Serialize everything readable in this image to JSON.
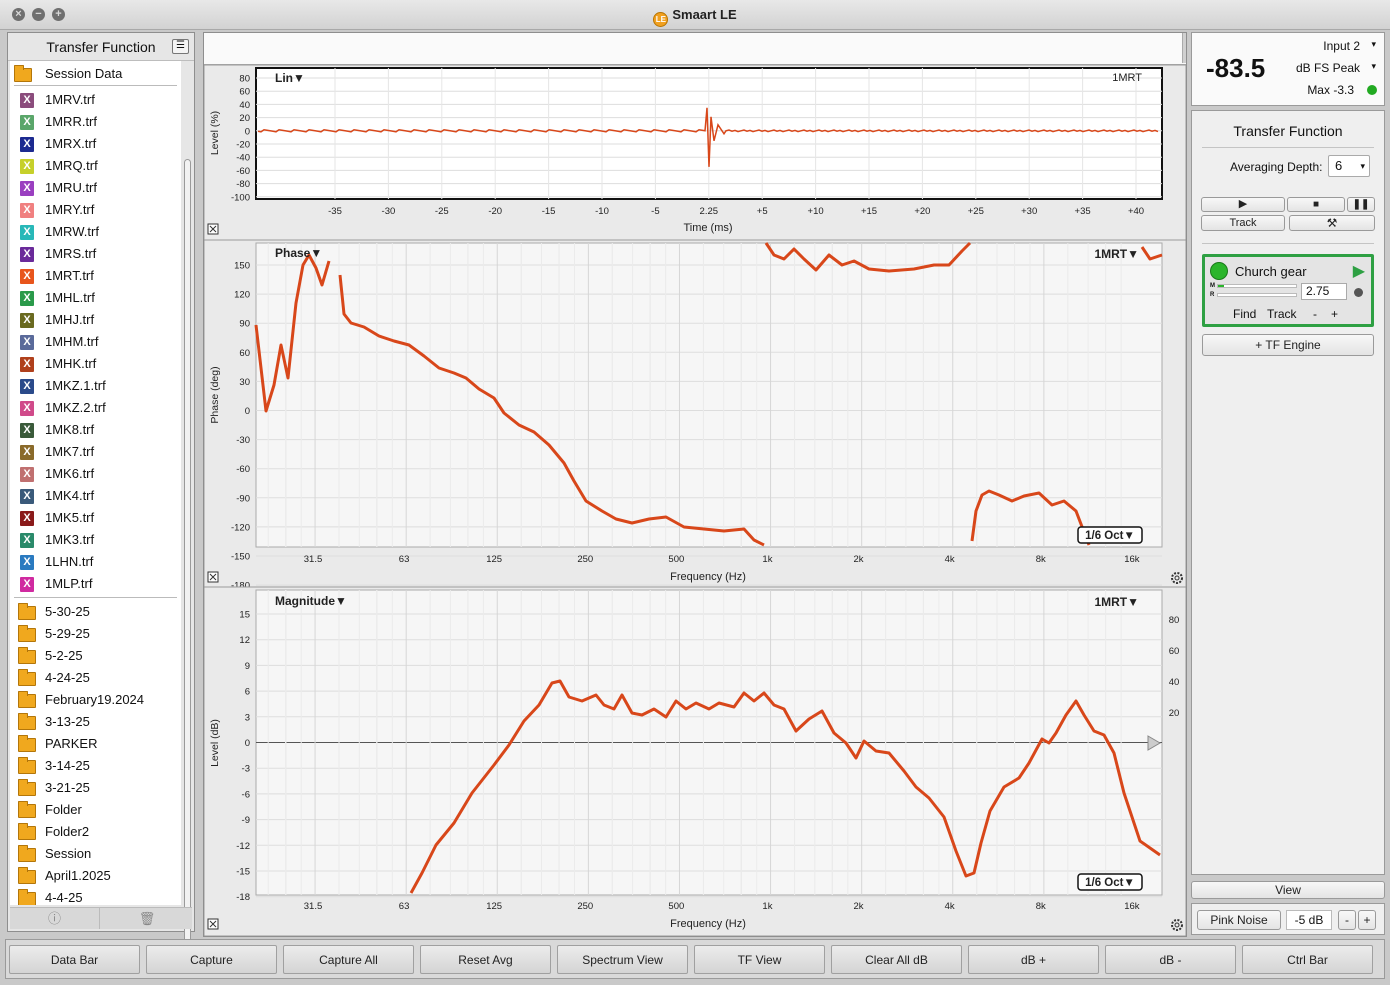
{
  "window": {
    "title": "Smaart LE",
    "logo_text": "LE"
  },
  "sidebar": {
    "title": "Transfer Function",
    "root": "Session Data",
    "files": [
      {
        "name": "1MRV.trf",
        "color": "#8b4c7c"
      },
      {
        "name": "1MRR.trf",
        "color": "#5aa66a"
      },
      {
        "name": "1MRX.trf",
        "color": "#1c2a90"
      },
      {
        "name": "1MRQ.trf",
        "color": "#c6d02a"
      },
      {
        "name": "1MRU.trf",
        "color": "#9a3fc0"
      },
      {
        "name": "1MRY.trf",
        "color": "#f08080"
      },
      {
        "name": "1MRW.trf",
        "color": "#28b8b8"
      },
      {
        "name": "1MRS.trf",
        "color": "#6a2a9a"
      },
      {
        "name": "1MRT.trf",
        "color": "#e8551c"
      },
      {
        "name": "1MHL.trf",
        "color": "#2a9a4a"
      },
      {
        "name": "1MHJ.trf",
        "color": "#6a6a20"
      },
      {
        "name": "1MHM.trf",
        "color": "#5a6a9a"
      },
      {
        "name": "1MHK.trf",
        "color": "#b0401c"
      },
      {
        "name": "1MKZ.1.trf",
        "color": "#2a4a8a"
      },
      {
        "name": "1MKZ.2.trf",
        "color": "#d04a8a"
      },
      {
        "name": "1MK8.trf",
        "color": "#3a5a3a"
      },
      {
        "name": "1MK7.trf",
        "color": "#8a6a2a"
      },
      {
        "name": "1MK6.trf",
        "color": "#c07070"
      },
      {
        "name": "1MK4.trf",
        "color": "#3a5a7a"
      },
      {
        "name": "1MK5.trf",
        "color": "#8a1a1a"
      },
      {
        "name": "1MK3.trf",
        "color": "#2a8a6a"
      },
      {
        "name": "1LHN.trf",
        "color": "#2a7ac0"
      },
      {
        "name": "1MLP.trf",
        "color": "#d02aa0"
      }
    ],
    "folders": [
      "5-30-25",
      "5-29-25",
      "5-2-25",
      "4-24-25",
      "February19.2024",
      "3-13-25",
      "PARKER",
      "3-14-25",
      "3-21-25",
      "Folder",
      "Folder2",
      "Session",
      "April1.2025",
      "4-4-25"
    ]
  },
  "ir_plot": {
    "mode": "Lin",
    "trace": "1MRT",
    "ylabel": "Level (%)",
    "xlabel": "Time (ms)",
    "yticks": [
      "80",
      "60",
      "40",
      "20",
      "0",
      "-20",
      "-40",
      "-60",
      "-80",
      "-100"
    ],
    "xticks": [
      "-35",
      "-30",
      "-25",
      "-20",
      "-15",
      "-10",
      "-5",
      "2.25",
      "+5",
      "+10",
      "+15",
      "+20",
      "+25",
      "+30",
      "+35",
      "+40"
    ]
  },
  "phase_plot": {
    "mode": "Phase",
    "trace": "1MRT",
    "smoothing": "1/6 Oct",
    "ylabel": "Phase (deg)",
    "xlabel": "Frequency (Hz)",
    "yticks": [
      "150",
      "120",
      "90",
      "60",
      "30",
      "0",
      "-30",
      "-60",
      "-90",
      "-120",
      "-150",
      "-180"
    ],
    "xticks": [
      "31.5",
      "63",
      "125",
      "250",
      "500",
      "1k",
      "2k",
      "4k",
      "8k",
      "16k"
    ]
  },
  "mag_plot": {
    "mode": "Magnitude",
    "trace": "1MRT",
    "smoothing": "1/6 Oct",
    "ylabel": "Level (dB)",
    "xlabel": "Frequency (Hz)",
    "yticks": [
      "15",
      "12",
      "9",
      "6",
      "3",
      "0",
      "-3",
      "-6",
      "-9",
      "-12",
      "-15",
      "-18"
    ],
    "right_ticks": [
      "80",
      "60",
      "40",
      "20"
    ],
    "xticks": [
      "31.5",
      "63",
      "125",
      "250",
      "500",
      "1k",
      "2k",
      "4k",
      "8k",
      "16k"
    ]
  },
  "meter": {
    "input": "Input 2",
    "value": "-83.5",
    "unit": "dB FS Peak",
    "max": "Max -3.3",
    "status_color": "#22aa22"
  },
  "tf_panel": {
    "title": "Transfer Function",
    "averaging_label": "Averaging Depth:",
    "averaging_value": "6",
    "track_label": "Track",
    "engine": {
      "name": "Church gear",
      "delay": "2.75",
      "find": "Find",
      "track": "Track",
      "minus": "-",
      "plus": "+",
      "meter_m": "M",
      "meter_r": "R"
    },
    "add_engine": "+ TF Engine"
  },
  "generator": {
    "view_label": "View",
    "signal": "Pink Noise",
    "level": "-5 dB",
    "minus": "-",
    "plus": "+"
  },
  "bottom_buttons": [
    "Data Bar",
    "Capture",
    "Capture All",
    "Reset Avg",
    "Spectrum View",
    "TF View",
    "Clear All dB",
    "dB +",
    "dB -",
    "Ctrl Bar"
  ],
  "colors": {
    "trace": "#d8471a",
    "engine_border": "#2ea043"
  }
}
